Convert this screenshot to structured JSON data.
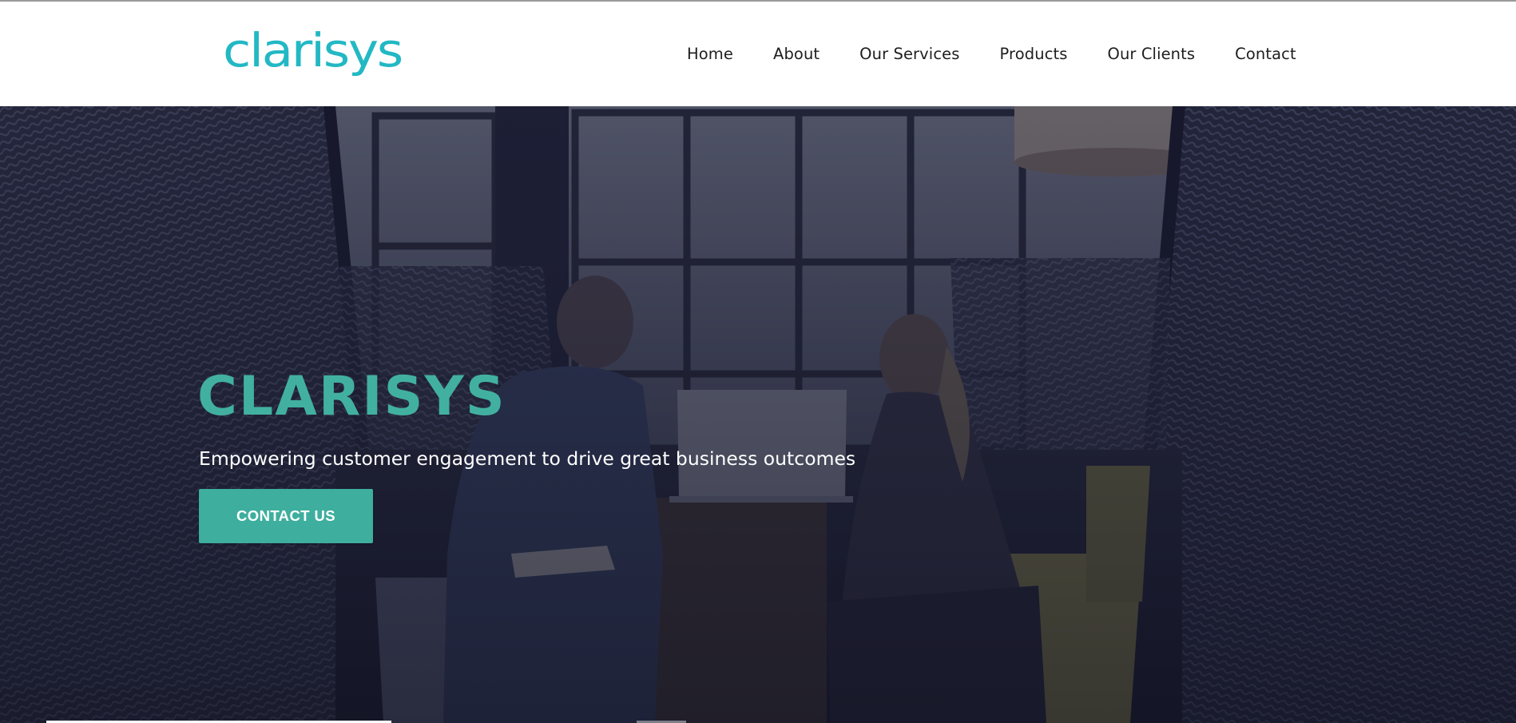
{
  "brand": {
    "logo_text": "clarisys",
    "accent_color": "#42b0a1",
    "button_color": "#3eae9e"
  },
  "nav": {
    "items": [
      {
        "label": "Home"
      },
      {
        "label": "About"
      },
      {
        "label": "Our Services"
      },
      {
        "label": "Products"
      },
      {
        "label": "Our Clients"
      },
      {
        "label": "Contact"
      }
    ]
  },
  "hero": {
    "title": "CLARISYS",
    "tagline": "Empowering customer engagement to drive great business outcomes",
    "cta_label": "CONTACT US"
  }
}
